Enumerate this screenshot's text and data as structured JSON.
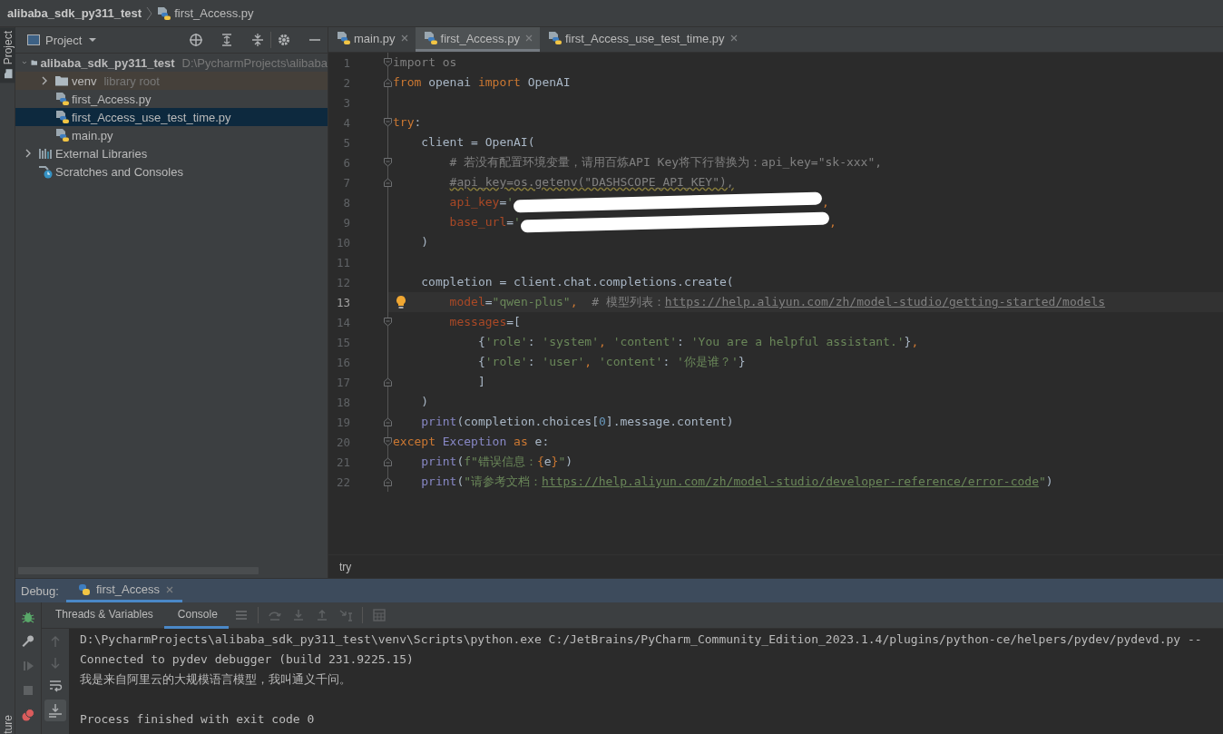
{
  "title_bar": {
    "project": "alibaba_sdk_py311_test",
    "file": "first_Access.py"
  },
  "tool_strip": {
    "tabs": [
      {
        "label": "Project",
        "selected": true
      }
    ],
    "bottom_tabs": [
      {
        "label": "ture",
        "selected": false
      }
    ]
  },
  "project_panel": {
    "title": "Project",
    "tree": [
      {
        "kind": "project",
        "name": "alibaba_sdk_py311_test",
        "hint": "D:\\PycharmProjects\\alibaba",
        "expanded": true,
        "selected": false,
        "children": [
          {
            "kind": "library-folder",
            "name": "venv",
            "hint": "library root",
            "expanded": false,
            "selected": false
          },
          {
            "kind": "python-file",
            "name": "first_Access.py",
            "selected": false
          },
          {
            "kind": "python-file",
            "name": "first_Access_use_test_time.py",
            "selected": true
          },
          {
            "kind": "python-file",
            "name": "main.py",
            "selected": false
          }
        ]
      },
      {
        "kind": "libraries",
        "name": "External Libraries",
        "expanded": false,
        "selected": false
      },
      {
        "kind": "scratches",
        "name": "Scratches and Consoles",
        "selected": false
      }
    ]
  },
  "editor": {
    "tabs": [
      {
        "label": "main.py",
        "selected": false
      },
      {
        "label": "first_Access.py",
        "selected": true
      },
      {
        "label": "first_Access_use_test_time.py",
        "selected": false
      }
    ],
    "lines": [
      {
        "number": "1",
        "current": false,
        "kind": "fold-start",
        "tokens": [
          {
            "kind": "dim",
            "text": "import os"
          }
        ]
      },
      {
        "number": "2",
        "current": false,
        "kind": "fold-end",
        "tokens": [
          {
            "kind": "kw",
            "text": "from"
          },
          {
            "kind": "plain",
            "text": " openai "
          },
          {
            "kind": "kw",
            "text": "import"
          },
          {
            "kind": "plain",
            "text": " OpenAI"
          }
        ]
      },
      {
        "number": "3",
        "current": false
      },
      {
        "number": "4",
        "current": false,
        "kind": "fold-start",
        "tokens": [
          {
            "kind": "kw",
            "text": "try"
          },
          {
            "kind": "plain",
            "text": ":"
          }
        ]
      },
      {
        "number": "5",
        "current": false,
        "tokens": [
          {
            "kind": "plain",
            "text": "    client = OpenAI("
          }
        ]
      },
      {
        "number": "6",
        "current": false,
        "kind": "fold-start",
        "tokens": [
          {
            "kind": "cmt",
            "text": "        # 若没有配置环境变量，请用百炼API Key将下行替换为：api_key=\"sk-xxx\","
          }
        ]
      },
      {
        "number": "7",
        "current": false,
        "kind": "fold-end",
        "tokens": [
          {
            "kind": "warn",
            "text": "        #api_key=os.getenv(\"DASHSCOPE_API_KEY\"),"
          }
        ]
      },
      {
        "number": "8",
        "current": false,
        "tokens": [
          {
            "kind": "param",
            "text": "        api_key"
          },
          {
            "kind": "plain",
            "text": "="
          },
          {
            "kind": "str",
            "text": "'"
          },
          {
            "kind": "redaction"
          },
          {
            "kind": "kw",
            "text": ","
          }
        ]
      },
      {
        "number": "9",
        "current": false,
        "tokens": [
          {
            "kind": "param",
            "text": "        base_url"
          },
          {
            "kind": "plain",
            "text": "="
          },
          {
            "kind": "str",
            "text": "'"
          },
          {
            "kind": "redaction"
          },
          {
            "kind": "kw",
            "text": ","
          }
        ]
      },
      {
        "number": "10",
        "current": false,
        "tokens": [
          {
            "kind": "plain",
            "text": "    )"
          }
        ]
      },
      {
        "number": "11",
        "current": false
      },
      {
        "number": "12",
        "current": false,
        "tokens": [
          {
            "kind": "plain",
            "text": "    completion = client.chat.completions.create("
          }
        ]
      },
      {
        "number": "13",
        "current": true,
        "tokens": [
          {
            "kind": "param",
            "text": "        model"
          },
          {
            "kind": "plain",
            "text": "="
          },
          {
            "kind": "str",
            "text": "\"qwen-plus\""
          },
          {
            "kind": "kw",
            "text": ",  "
          },
          {
            "kind": "cmt",
            "text": "# 模型列表："
          },
          {
            "kind": "link",
            "text": "https://help.aliyun.com/zh/model-studio/getting-started/models"
          }
        ]
      },
      {
        "number": "14",
        "current": false,
        "kind": "fold-start",
        "tokens": [
          {
            "kind": "param",
            "text": "        messages"
          },
          {
            "kind": "plain",
            "text": "=["
          }
        ]
      },
      {
        "number": "15",
        "current": false,
        "tokens": [
          {
            "kind": "plain",
            "text": "            {"
          },
          {
            "kind": "str",
            "text": "'role'"
          },
          {
            "kind": "plain",
            "text": ": "
          },
          {
            "kind": "str",
            "text": "'system'"
          },
          {
            "kind": "kw",
            "text": ", "
          },
          {
            "kind": "str",
            "text": "'content'"
          },
          {
            "kind": "plain",
            "text": ": "
          },
          {
            "kind": "str",
            "text": "'You are a helpful assistant.'"
          },
          {
            "kind": "plain",
            "text": "}"
          },
          {
            "kind": "kw",
            "text": ","
          }
        ]
      },
      {
        "number": "16",
        "current": false,
        "tokens": [
          {
            "kind": "plain",
            "text": "            {"
          },
          {
            "kind": "str",
            "text": "'role'"
          },
          {
            "kind": "plain",
            "text": ": "
          },
          {
            "kind": "str",
            "text": "'user'"
          },
          {
            "kind": "kw",
            "text": ", "
          },
          {
            "kind": "str",
            "text": "'content'"
          },
          {
            "kind": "plain",
            "text": ": "
          },
          {
            "kind": "str",
            "text": "'你是谁？'"
          },
          {
            "kind": "plain",
            "text": "}"
          }
        ]
      },
      {
        "number": "17",
        "current": false,
        "kind": "fold-end",
        "tokens": [
          {
            "kind": "plain",
            "text": "            ]"
          }
        ]
      },
      {
        "number": "18",
        "current": false,
        "tokens": [
          {
            "kind": "plain",
            "text": "    )"
          }
        ]
      },
      {
        "number": "19",
        "current": false,
        "kind": "fold-end",
        "tokens": [
          {
            "kind": "builtin",
            "text": "    print"
          },
          {
            "kind": "plain",
            "text": "(completion.choices["
          },
          {
            "kind": "num",
            "text": "0"
          },
          {
            "kind": "plain",
            "text": "].message.content)"
          }
        ]
      },
      {
        "number": "20",
        "current": false,
        "kind": "fold-start",
        "tokens": [
          {
            "kind": "kw",
            "text": "except"
          },
          {
            "kind": "builtin",
            "text": " Exception"
          },
          {
            "kind": "kw",
            "text": " as"
          },
          {
            "kind": "plain",
            "text": " e:"
          }
        ]
      },
      {
        "number": "21",
        "current": false,
        "kind": "fold-end",
        "tokens": [
          {
            "kind": "builtin",
            "text": "    print"
          },
          {
            "kind": "plain",
            "text": "("
          },
          {
            "kind": "str",
            "text": "f\"错误信息："
          },
          {
            "kind": "kw",
            "text": "{"
          },
          {
            "kind": "plain",
            "text": "e"
          },
          {
            "kind": "kw",
            "text": "}"
          },
          {
            "kind": "str",
            "text": "\""
          },
          {
            "kind": "plain",
            "text": ")"
          }
        ]
      },
      {
        "number": "22",
        "current": false,
        "kind": "fold-end",
        "tokens": [
          {
            "kind": "builtin",
            "text": "    print"
          },
          {
            "kind": "plain",
            "text": "("
          },
          {
            "kind": "str",
            "text": "\"请参考文档："
          },
          {
            "kind": "strlink",
            "text": "https://help.aliyun.com/zh/model-studio/developer-reference/error-code"
          },
          {
            "kind": "str",
            "text": "\""
          },
          {
            "kind": "plain",
            "text": ")"
          }
        ]
      }
    ],
    "breadcrumb": "try"
  },
  "debug": {
    "title": "Debug:",
    "sessions": [
      {
        "label": "first_Access",
        "selected": true
      }
    ],
    "tabs": [
      {
        "label": "Threads & Variables",
        "selected": false
      },
      {
        "label": "Console",
        "selected": true
      }
    ],
    "autoscroll_on": true,
    "console": [
      {
        "kind": "stdout",
        "text": "D:\\PycharmProjects\\alibaba_sdk_py311_test\\venv\\Scripts\\python.exe C:/JetBrains/PyCharm_Community_Edition_2023.1.4/plugins/python-ce/helpers/pydev/pydevd.py --"
      },
      {
        "kind": "stdout",
        "text": "Connected to pydev debugger (build 231.9225.15)"
      },
      {
        "kind": "stdout",
        "text": "我是来自阿里云的大规模语言模型，我叫通义千问。"
      },
      {
        "kind": "exit",
        "text": "Process finished with exit code 0"
      }
    ]
  }
}
